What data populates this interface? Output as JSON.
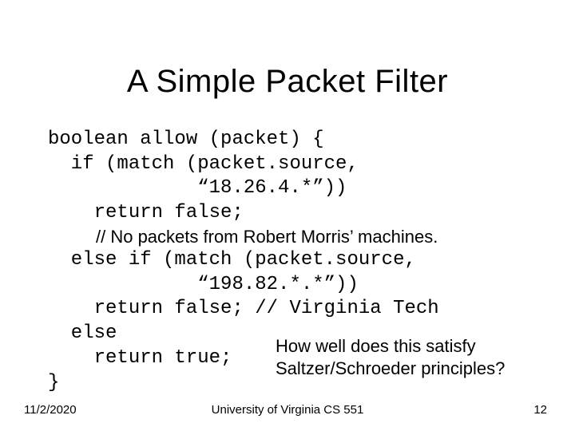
{
  "title": "A Simple Packet Filter",
  "code": {
    "l1": "boolean allow (packet) {",
    "l2": "  if (match (packet.source,",
    "l3": "             “18.26.4.*”))",
    "l4": "    return false;",
    "comment1": "// No packets from Robert Morris’ machines.",
    "l5": "  else if (match (packet.source,",
    "l6": "             “198.82.*.*”))",
    "l7": "    return false; // Virginia Tech",
    "l8": "  else",
    "l9": "    return true;",
    "l10": "}"
  },
  "question": "How well does this satisfy Saltzer/Schroeder principles?",
  "footer": {
    "date": "11/2/2020",
    "center": "University of Virginia CS 551",
    "page": "12"
  }
}
